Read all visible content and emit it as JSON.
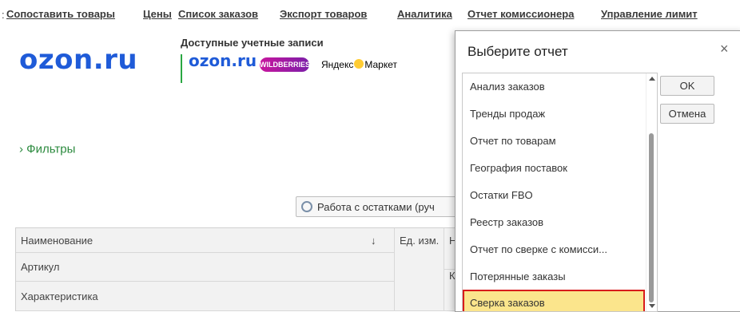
{
  "nav": {
    "lead": ":",
    "links": [
      "Сопоставить товары",
      "Цены",
      "Список заказов",
      "Экспорт товаров",
      "Аналитика",
      "Отчет комиссионера",
      "Управление лимит"
    ]
  },
  "brand": {
    "main_logo": "ozon.ru"
  },
  "accounts": {
    "title": "Доступные учетные записи",
    "logos": [
      "ozon.ru",
      "WILDBERRIES",
      "Яндекс",
      "Маркет"
    ]
  },
  "filters": {
    "label": "Фильтры",
    "icon": "chevron-right-icon"
  },
  "toolbar": {
    "stock_button": "Работа с остатками (руч"
  },
  "table": {
    "headers": [
      "Наименование",
      "↓",
      "Ед. изм.",
      "Н"
    ],
    "rows": [
      "Артикул",
      "Характеристика"
    ],
    "extra_col_cell": "К"
  },
  "dialog": {
    "title": "Выберите отчет",
    "close": "×",
    "items": [
      "Анализ заказов",
      "Тренды продаж",
      "Отчет по товарам",
      "География поставок",
      "Остатки FBO",
      "Реестр заказов",
      "Отчет по сверке с комисси...",
      "Потерянные заказы",
      "Сверка заказов"
    ],
    "selected_index": 8,
    "ok": "OK",
    "cancel": "Отмена"
  },
  "colors": {
    "highlight": "#fbe58c",
    "outline": "#d81b1b",
    "ozon": "#1f5bd8",
    "accent_green": "#2aa742"
  }
}
